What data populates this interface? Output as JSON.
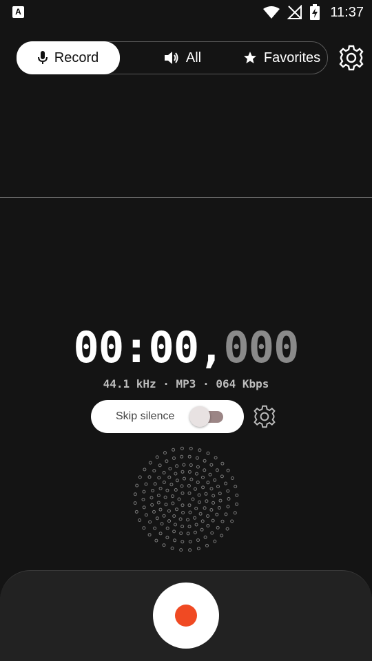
{
  "status_bar": {
    "app_icon_letter": "A",
    "time": "11:37",
    "icons": [
      "wifi-icon",
      "no-signal-icon",
      "battery-charging-icon"
    ]
  },
  "tabs": [
    {
      "label": "Record",
      "icon": "microphone-icon",
      "active": true
    },
    {
      "label": "All",
      "icon": "speaker-icon",
      "active": false
    },
    {
      "label": "Favorites",
      "icon": "star-icon",
      "active": false
    }
  ],
  "timer": {
    "main": "00:00",
    "separator": ",",
    "ms": "000"
  },
  "audio_info": "44.1 kHz · MP3 · 064 Kbps",
  "skip_silence": {
    "label": "Skip silence",
    "enabled": false
  },
  "colors": {
    "background": "#141414",
    "accent_record": "#f04a23",
    "panel": "#222222"
  }
}
